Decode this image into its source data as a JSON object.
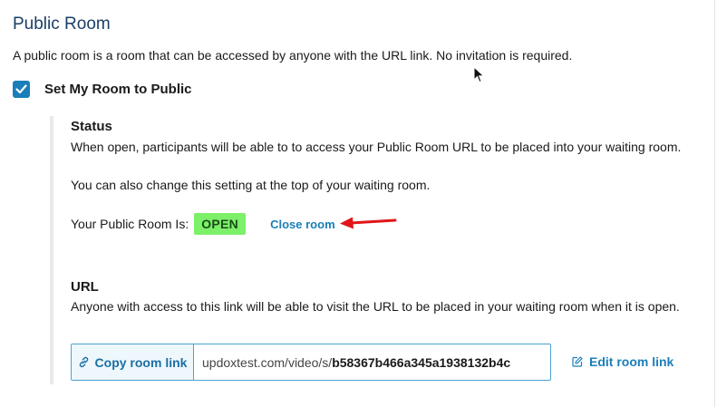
{
  "section": {
    "title": "Public Room",
    "intro": "A public room is a room that can be accessed by anyone with the URL link. No invitation is required."
  },
  "public_toggle": {
    "label": "Set My Room to Public",
    "checked": true
  },
  "status": {
    "heading": "Status",
    "description_1": "When open, participants will be able to to access your Public Room URL to be placed into your waiting room.",
    "description_2": "You can also change this setting at the top of your waiting room.",
    "label": "Your Public Room Is:",
    "badge": "OPEN",
    "close_link": "Close room"
  },
  "url": {
    "heading": "URL",
    "description": "Anyone with access to this link will be able to visit the URL to be placed in your waiting room when it is open.",
    "copy_label": "Copy room link",
    "url_prefix": "updoxtest.com/video/s/",
    "url_code": "b58367b466a345a1938132b4c",
    "edit_label": "Edit room link"
  },
  "colors": {
    "accent": "#1a7fb8",
    "badge_bg": "#7cf068",
    "title": "#1b3f66",
    "arrow": "#e0161a"
  }
}
